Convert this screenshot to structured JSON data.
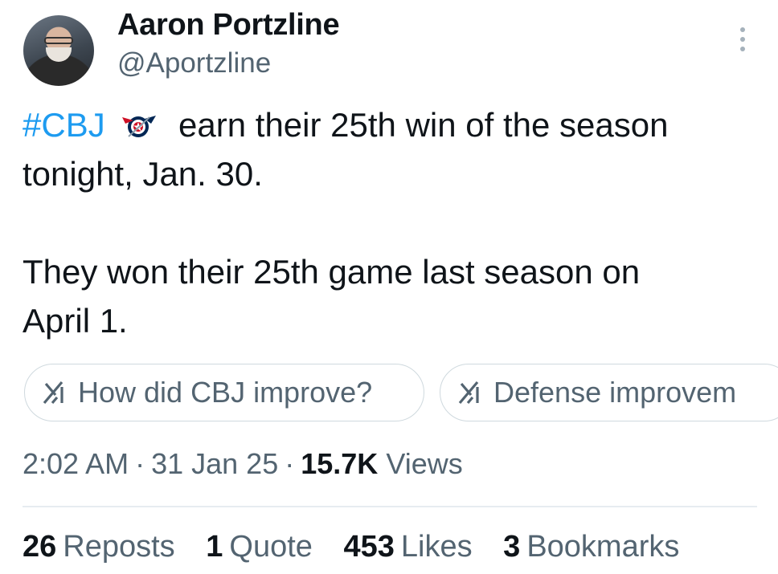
{
  "author": {
    "display_name": "Aaron Portzline",
    "handle": "@Aportzline"
  },
  "tweet": {
    "hashtag": "#CBJ",
    "line1_rest": "earn their 25th win of the season",
    "line2": "tonight, Jan. 30.",
    "line3": "They won their 25th game last season on",
    "line4": "April 1."
  },
  "suggestions": [
    {
      "label": "How did CBJ improve?",
      "icon": "grok-icon"
    },
    {
      "label": "Defense improvem",
      "icon": "grok-icon"
    }
  ],
  "meta": {
    "time": "2:02 AM",
    "separator": "·",
    "date": "31 Jan 25",
    "views_count": "15.7K",
    "views_label": "Views"
  },
  "stats": {
    "reposts": {
      "count": "26",
      "label": "Reposts"
    },
    "quotes": {
      "count": "1",
      "label": "Quote"
    },
    "likes": {
      "count": "453",
      "label": "Likes"
    },
    "bookmarks": {
      "count": "3",
      "label": "Bookmarks"
    }
  },
  "colors": {
    "link": "#1d9bf0",
    "secondary_text": "#536471",
    "primary_text": "#0f1419",
    "border": "#cfd9de"
  }
}
